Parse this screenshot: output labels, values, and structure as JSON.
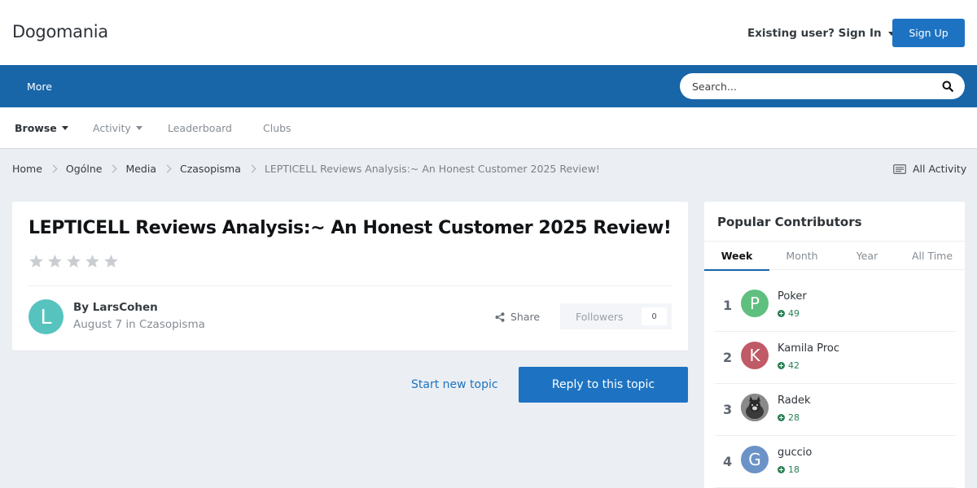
{
  "header": {
    "logo": "Dogomania",
    "signin_label": "Existing user? Sign In",
    "signup_label": "Sign Up"
  },
  "navbar": {
    "more_label": "More",
    "search_placeholder": "Search..."
  },
  "subnav": {
    "items": [
      {
        "label": "Browse",
        "active": true,
        "has_caret": true
      },
      {
        "label": "Activity",
        "active": false,
        "has_caret": true
      },
      {
        "label": "Leaderboard",
        "active": false,
        "has_caret": false
      },
      {
        "label": "Clubs",
        "active": false,
        "has_caret": false
      }
    ]
  },
  "breadcrumb": {
    "items": [
      "Home",
      "Ogólne",
      "Media",
      "Czasopisma",
      "LEPTICELL Reviews Analysis:~ An Honest Customer 2025 Review!"
    ],
    "all_activity_label": "All Activity"
  },
  "topic": {
    "title": "LEPTICELL Reviews Analysis:~ An Honest Customer 2025 Review!",
    "rating": 0,
    "rating_max": 5,
    "author_initial": "L",
    "author_line": "By LarsCohen",
    "date": "August 7",
    "in_word": "in",
    "forum": "Czasopisma",
    "share_label": "Share",
    "followers_label": "Followers",
    "followers_count": "0"
  },
  "actions": {
    "start_new_topic": "Start new topic",
    "reply": "Reply to this topic"
  },
  "sidebar": {
    "title": "Popular Contributors",
    "tabs": [
      "Week",
      "Month",
      "Year",
      "All Time"
    ],
    "active_tab": "Week",
    "contributors": [
      {
        "rank": "1",
        "initial": "P",
        "name": "Poker",
        "rep": "49",
        "color": "#5fbf7f"
      },
      {
        "rank": "2",
        "initial": "K",
        "name": "Kamila Proc",
        "rep": "42",
        "color": "#c05a66"
      },
      {
        "rank": "3",
        "initial": "",
        "name": "Radek",
        "rep": "28",
        "color": "#5a5a5a"
      },
      {
        "rank": "4",
        "initial": "G",
        "name": "guccio",
        "rep": "18",
        "color": "#6b93c7"
      }
    ]
  },
  "colors": {
    "brand_blue": "#1865a8",
    "button_blue": "#1d73c2",
    "reputation_green": "#2a8055"
  }
}
